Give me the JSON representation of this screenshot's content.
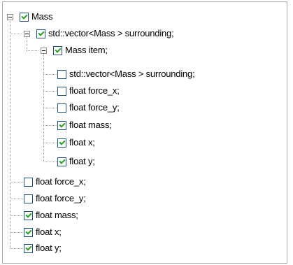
{
  "tree": {
    "root": {
      "label": "Mass",
      "checked": true,
      "expanded": true
    },
    "vector": {
      "label": "std::vector<Mass > surrounding;",
      "checked": true,
      "expanded": true
    },
    "item": {
      "label": "Mass item;",
      "checked": true,
      "expanded": true
    },
    "item_children": [
      {
        "label": "std::vector<Mass > surrounding;",
        "checked": false
      },
      {
        "label": "float force_x;",
        "checked": false
      },
      {
        "label": "float force_y;",
        "checked": false
      },
      {
        "label": "float mass;",
        "checked": true
      },
      {
        "label": "float x;",
        "checked": true
      },
      {
        "label": "float y;",
        "checked": true
      }
    ],
    "root_children": [
      {
        "label": "float force_x;",
        "checked": false
      },
      {
        "label": "float force_y;",
        "checked": false
      },
      {
        "label": "float mass;",
        "checked": true
      },
      {
        "label": "float x;",
        "checked": true
      },
      {
        "label": "float y;",
        "checked": true
      }
    ]
  },
  "colors": {
    "check": "#21a121",
    "checkbox_border": "#1c5180",
    "tree_line": "#a0a0a0"
  }
}
